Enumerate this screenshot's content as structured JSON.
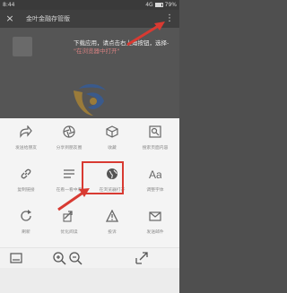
{
  "status_bar": {
    "time": "8:44",
    "signal_text": "4G",
    "battery": "79%"
  },
  "title_bar": {
    "title": "金叶金融存管版",
    "close_label": "×",
    "more_label": "⋮"
  },
  "banner": {
    "text": "下载应用，请点击右上角按钮，选择-",
    "link": "\"在浏览器中打开\""
  },
  "page": {
    "logo_name": "Kill-Leaf Finance Nutle"
  },
  "share_sheet": {
    "rows": [
      {
        "items": [
          {
            "label": "发送给朋友",
            "icon": "share-arrow-icon"
          },
          {
            "label": "分享到朋友圈",
            "icon": "moments-icon"
          },
          {
            "label": "收藏",
            "icon": "cube-icon"
          },
          {
            "label": "搜索页面内容",
            "icon": "search-page-icon"
          }
        ]
      },
      {
        "items": [
          {
            "label": "复制链接",
            "icon": "link-icon"
          },
          {
            "label": "在看一看中看",
            "icon": "list-icon"
          },
          {
            "label": "在浏览器打开",
            "icon": "globe-icon"
          },
          {
            "label": "调整字体",
            "icon": "font-icon"
          }
        ]
      },
      {
        "items": [
          {
            "label": "刷新",
            "icon": "refresh-icon"
          },
          {
            "label": "优化阅读",
            "icon": "link2-icon"
          },
          {
            "label": "投诉",
            "icon": "warning-icon"
          },
          {
            "label": "发送邮件",
            "icon": "mail-icon"
          }
        ]
      },
      {
        "items": [
          {
            "label": "",
            "icon": "chat-bubble-icon"
          },
          {
            "label": "",
            "icon": "cloud-icon"
          },
          {
            "label": "",
            "icon": "blank"
          },
          {
            "label": "",
            "icon": "star-icon"
          }
        ]
      }
    ],
    "highlight_color": "#d83a32"
  },
  "bottom_bar": {
    "tools": [
      {
        "icon": "minimize-icon"
      },
      {
        "icon": "zoom-in-icon"
      },
      {
        "icon": "zoom-out-icon"
      },
      {
        "icon": "external-icon"
      }
    ]
  },
  "colors": {
    "accent_red": "#d83a32",
    "sheet_bg": "#f4f4f4",
    "icon_gray": "#666666",
    "star_yellow": "#f2c21b",
    "chat_blue": "#1a9be8"
  }
}
